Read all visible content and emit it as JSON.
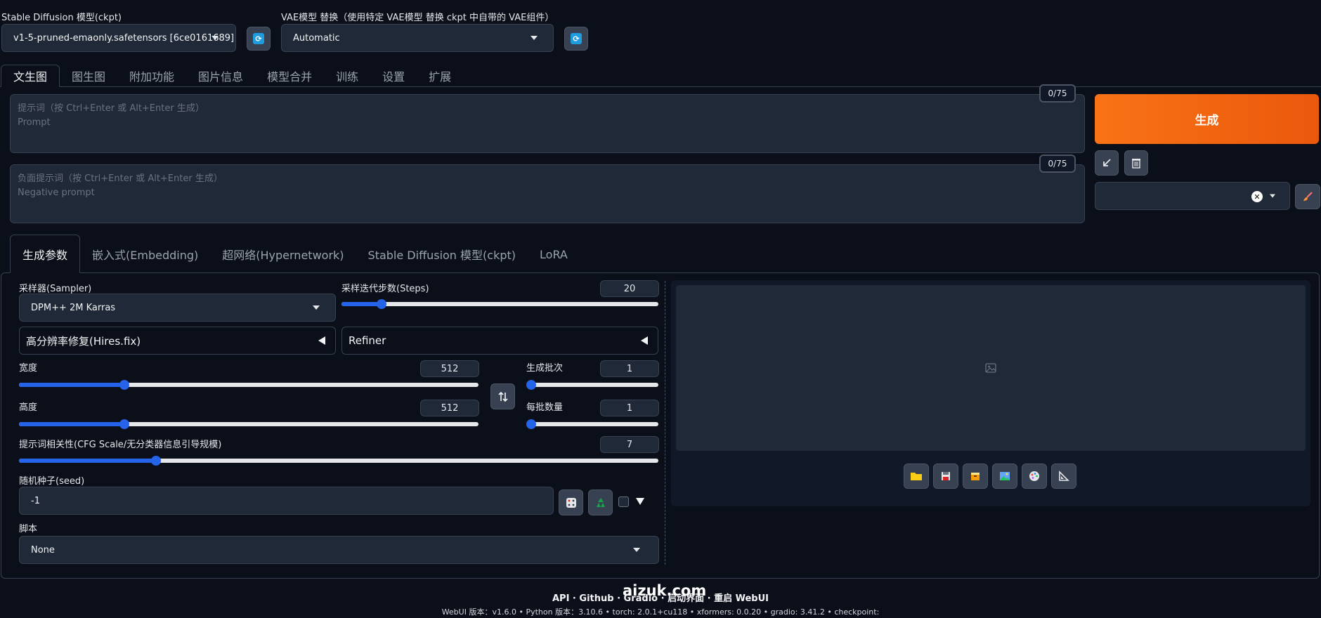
{
  "header": {
    "sd_model_label": "Stable Diffusion 模型(ckpt)",
    "sd_model_value": "v1-5-pruned-emaonly.safetensors [6ce0161689]",
    "vae_label": "VAE模型 替换（使用特定 VAE模型 替换 ckpt 中自带的 VAE组件）",
    "vae_value": "Automatic"
  },
  "main_tabs": [
    "文生图",
    "图生图",
    "附加功能",
    "图片信息",
    "模型合并",
    "训练",
    "设置",
    "扩展"
  ],
  "prompt": {
    "placeholder_line1": "提示词（按 Ctrl+Enter 或 Alt+Enter 生成）",
    "placeholder_line2": "Prompt",
    "counter": "0/75"
  },
  "negative_prompt": {
    "placeholder_line1": "负面提示词（按 Ctrl+Enter 或 Alt+Enter 生成）",
    "placeholder_line2": "Negative prompt",
    "counter": "0/75"
  },
  "generate_label": "生成",
  "sub_tabs": [
    "生成参数",
    "嵌入式(Embedding)",
    "超网络(Hypernetwork)",
    "Stable Diffusion 模型(ckpt)",
    "LoRA"
  ],
  "params": {
    "sampler_label": "采样器(Sampler)",
    "sampler_value": "DPM++ 2M Karras",
    "steps_label": "采样迭代步数(Steps)",
    "steps_value": "20",
    "steps_fraction": 0.127,
    "hires_label": "高分辨率修复(Hires.fix)",
    "refiner_label": "Refiner",
    "width_label": "宽度",
    "width_value": "512",
    "width_fraction": 0.23,
    "height_label": "高度",
    "height_value": "512",
    "height_fraction": 0.23,
    "batch_count_label": "生成批次",
    "batch_count_value": "1",
    "batch_count_fraction": 0.0,
    "batch_size_label": "每批数量",
    "batch_size_value": "1",
    "batch_size_fraction": 0.0,
    "cfg_label": "提示词相关性(CFG Scale/无分类器信息引导规模)",
    "cfg_value": "7",
    "cfg_fraction": 0.214,
    "seed_label": "随机种子(seed)",
    "seed_value": "-1",
    "script_label": "脚本",
    "script_value": "None"
  },
  "footer": {
    "links": "API  ·  Github  ·  Gradio  ·  启动界面  ·  重启 WebUI",
    "watermark": "aizuk.com",
    "versions": "WebUI 版本：v1.6.0  •  Python 版本：3.10.6  •  torch: 2.0.1+cu118  •  xformers: 0.0.20  •  gradio: 3.41.2  •  checkpoint:"
  }
}
